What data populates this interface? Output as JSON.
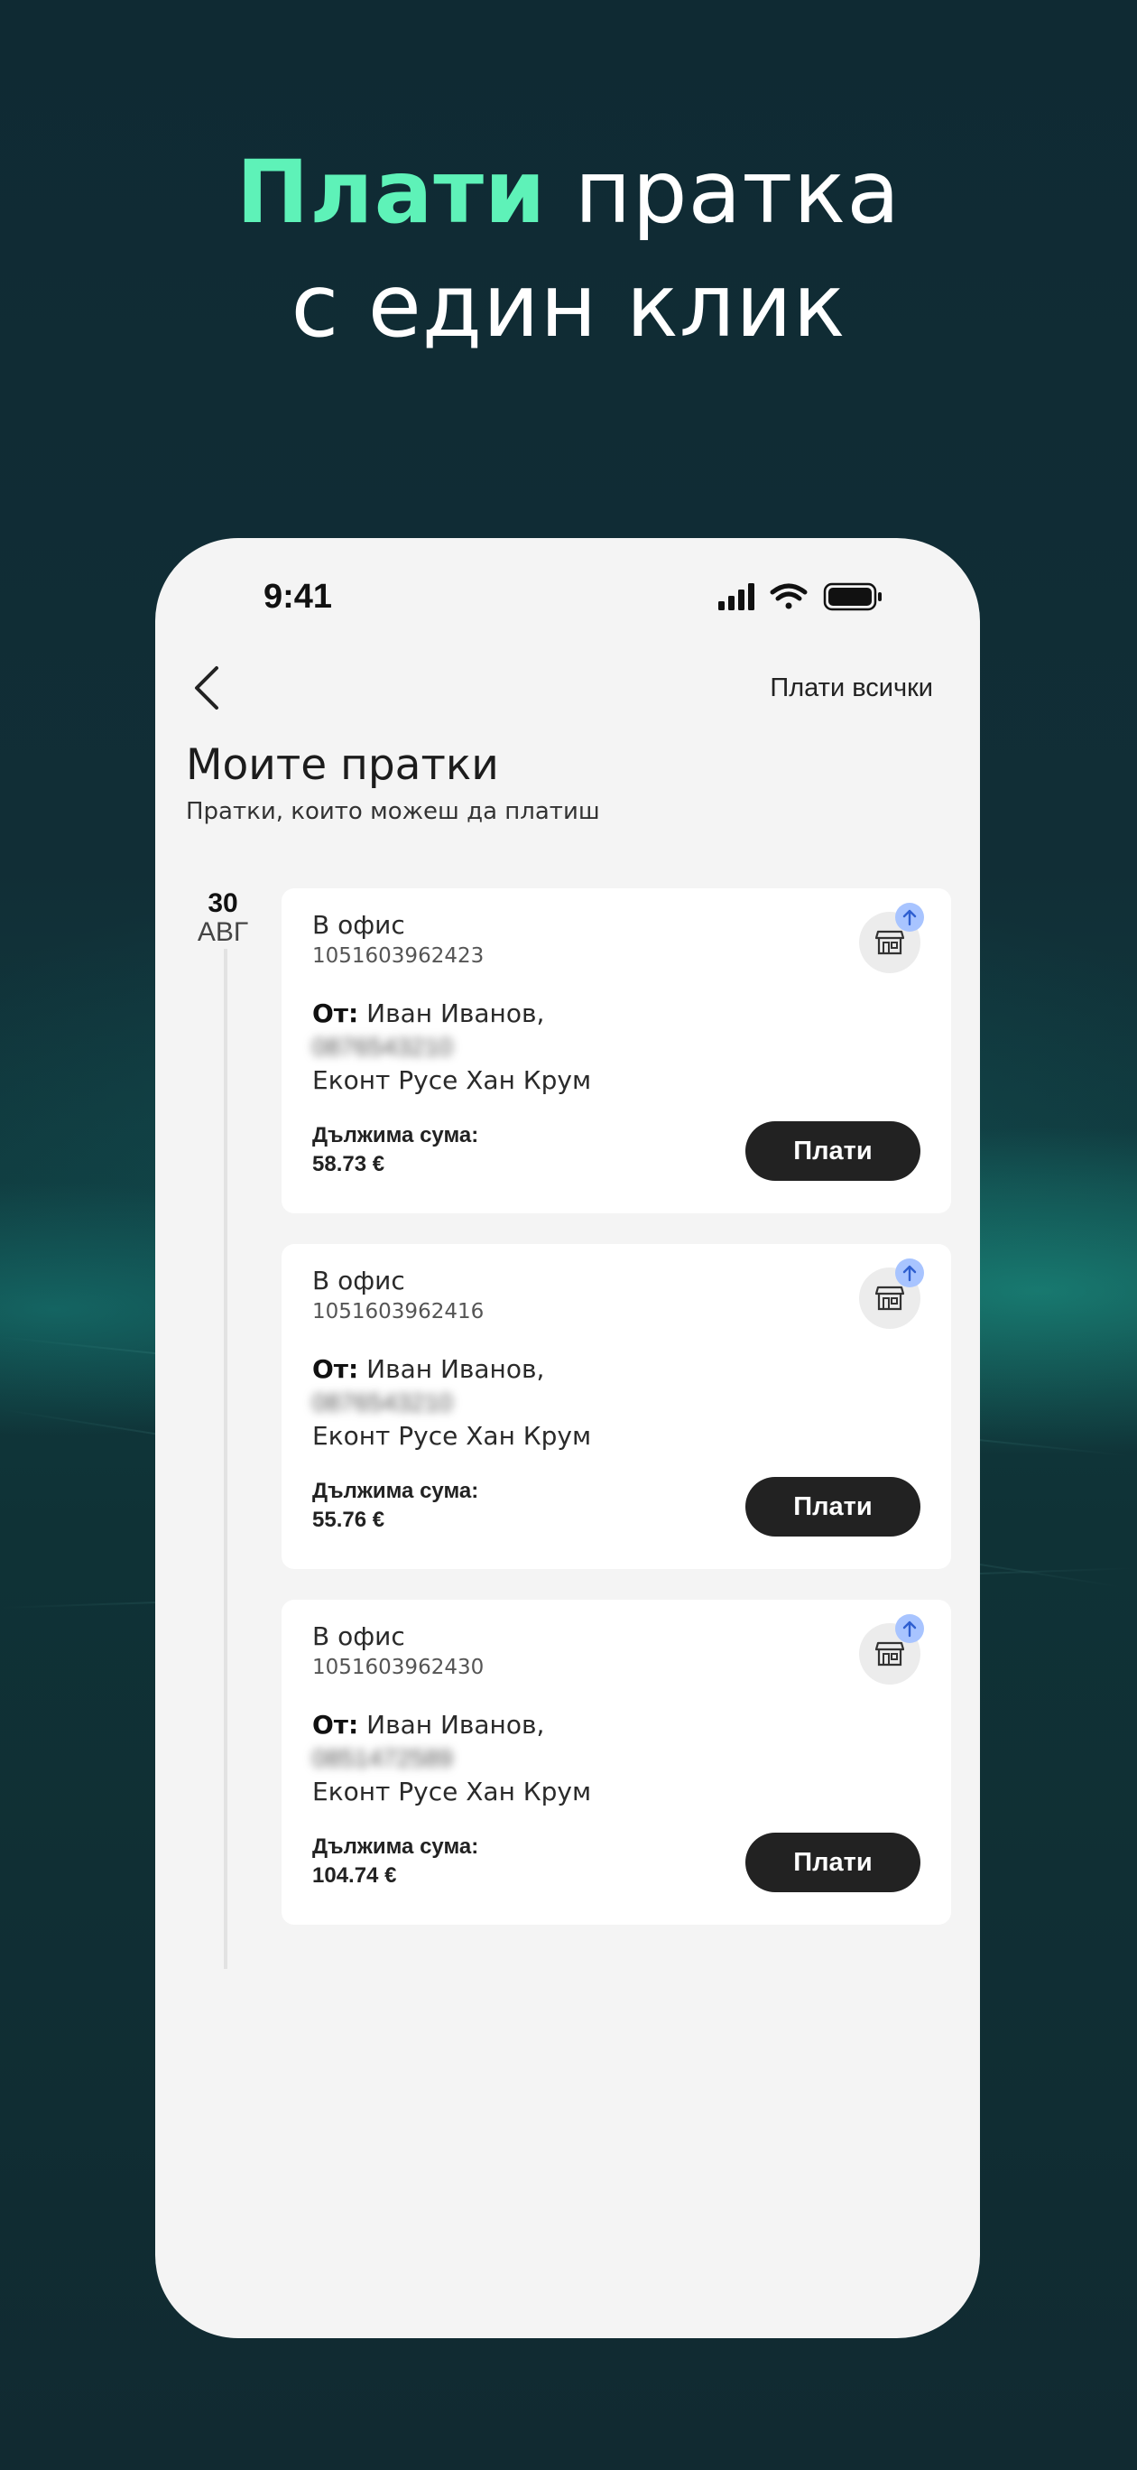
{
  "headline": {
    "accent": "Плати",
    "rest1": " пратка",
    "line2": "с един клик"
  },
  "status_bar": {
    "time": "9:41"
  },
  "nav": {
    "pay_all": "Плати всички"
  },
  "page": {
    "title": "Моите пратки",
    "subtitle": "Пратки, които можеш да платиш"
  },
  "date": {
    "day": "30",
    "month": "АВГ"
  },
  "labels": {
    "from": "От:",
    "amount_due": "Дължима сума:",
    "pay": "Плати"
  },
  "shipments": [
    {
      "type": "В офис",
      "number": "1051603962423",
      "sender": "Иван Иванов,",
      "phone": "0876543210",
      "office": "Еконт Русе Хан Крум",
      "amount": "58.73 €"
    },
    {
      "type": "В офис",
      "number": "1051603962416",
      "sender": "Иван Иванов,",
      "phone": "0876543210",
      "office": "Еконт Русе Хан Крум",
      "amount": "55.76 €"
    },
    {
      "type": "В офис",
      "number": "1051603962430",
      "sender": "Иван Иванов,",
      "phone": "0851472589",
      "office": "Еконт Русе Хан Крум",
      "amount": "104.74 €"
    }
  ],
  "icons": {
    "back": "chevron-left-icon",
    "office": "store-icon",
    "badge": "arrow-up-icon",
    "signal": "cellular-signal-icon",
    "wifi": "wifi-icon",
    "battery": "battery-icon"
  },
  "colors": {
    "accent": "#5ef2b8",
    "button": "#222222",
    "badge": "#a8c4ff"
  }
}
